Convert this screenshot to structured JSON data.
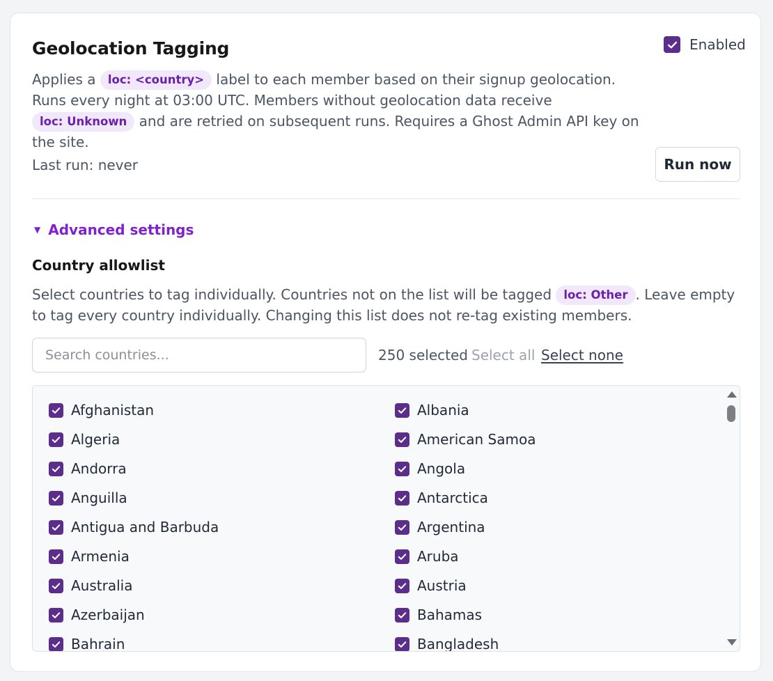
{
  "header": {
    "title": "Geolocation Tagging",
    "enabled_label": "Enabled",
    "enabled": true
  },
  "description": {
    "part1": "Applies a ",
    "pill_country": "loc: <country>",
    "part2": " label to each member based on their signup geolocation. Runs every night at 03:00 UTC. Members without geolocation data receive ",
    "pill_unknown": "loc: Unknown",
    "part3": " and are retried on subsequent runs. Requires a Ghost Admin API key on the site."
  },
  "status": {
    "last_run": "Last run: never",
    "run_button": "Run now"
  },
  "advanced": {
    "toggle_label": "Advanced settings",
    "expanded": true
  },
  "allowlist": {
    "title": "Country allowlist",
    "desc_part1": "Select countries to tag individually. Countries not on the list will be tagged ",
    "pill_other": "loc: Other",
    "desc_part2": ". Leave empty to tag every country individually. Changing this list does not re-tag existing members.",
    "search_placeholder": "Search countries...",
    "search_value": "",
    "selected_count": "250 selected",
    "select_all": "Select all",
    "select_none": "Select none",
    "countries": [
      "Afghanistan",
      "Albania",
      "Algeria",
      "American Samoa",
      "Andorra",
      "Angola",
      "Anguilla",
      "Antarctica",
      "Antigua and Barbuda",
      "Argentina",
      "Armenia",
      "Aruba",
      "Australia",
      "Austria",
      "Azerbaijan",
      "Bahamas",
      "Bahrain",
      "Bangladesh"
    ]
  },
  "colors": {
    "accent": "#7e22ce",
    "checkbox": "#5b2e8c",
    "pill_bg": "#f1e8fb",
    "pill_text": "#6b21a8"
  }
}
